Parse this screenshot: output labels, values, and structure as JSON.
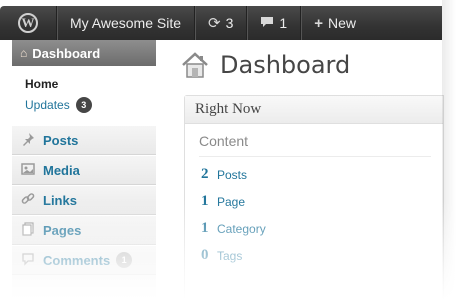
{
  "adminbar": {
    "site_name": "My Awesome Site",
    "updates_count": "3",
    "comments_count": "1",
    "new_label": "New"
  },
  "sidebar": {
    "dashboard_label": "Dashboard",
    "submenu": {
      "home_label": "Home",
      "updates_label": "Updates",
      "updates_badge": "3"
    },
    "items": [
      {
        "label": "Posts",
        "icon": "pushpin-icon"
      },
      {
        "label": "Media",
        "icon": "media-icon"
      },
      {
        "label": "Links",
        "icon": "link-icon"
      },
      {
        "label": "Pages",
        "icon": "pages-icon"
      },
      {
        "label": "Comments",
        "icon": "comment-icon",
        "badge": "1"
      }
    ]
  },
  "main": {
    "page_title": "Dashboard",
    "right_now": {
      "title": "Right Now",
      "section_title": "Content",
      "rows": [
        {
          "count": "2",
          "label": "Posts"
        },
        {
          "count": "1",
          "label": "Page"
        },
        {
          "count": "1",
          "label": "Category"
        },
        {
          "count": "0",
          "label": "Tags"
        }
      ]
    }
  },
  "colors": {
    "link": "#21759b",
    "adminbar": "#333333",
    "dashboard_active": "#777777"
  }
}
